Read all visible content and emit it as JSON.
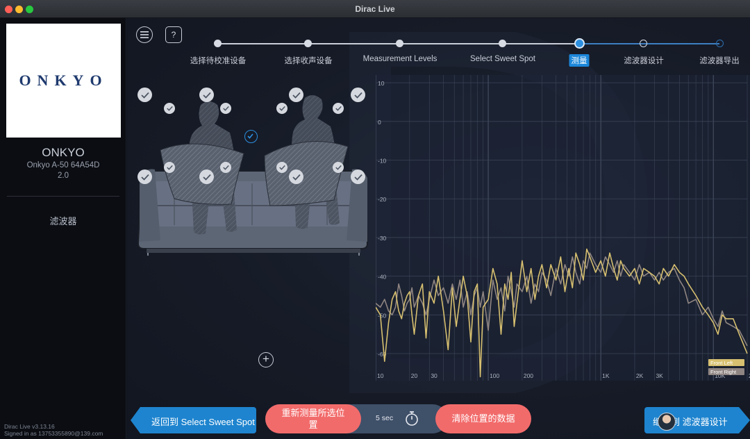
{
  "window": {
    "title": "Dirac Live"
  },
  "sidebar": {
    "logo_text": "ONKYO",
    "device_name": "ONKYO",
    "device_model": "Onkyo A-50 64A54D",
    "device_version": "2.0",
    "filter_label": "滤波器",
    "app_version": "Dirac Live v3.13.16",
    "signed_in": "Signed in as 13753355890@139.com"
  },
  "toolbar": {
    "menu_icon": "hamburger-menu-icon",
    "help_label": "?"
  },
  "stepper": {
    "steps": [
      {
        "label": "选择待校准设备",
        "state": "done"
      },
      {
        "label": "选择收声设备",
        "state": "done"
      },
      {
        "label": "Measurement Levels",
        "state": "done"
      },
      {
        "label": "Select Sweet Spot",
        "state": "done"
      },
      {
        "label": "测量",
        "state": "active"
      },
      {
        "label": "滤波器设计",
        "state": "future"
      },
      {
        "label": "滤波器导出",
        "state": "future"
      }
    ]
  },
  "scene": {
    "add_label": "+"
  },
  "chart_data": {
    "type": "line",
    "xscale": "log",
    "xlim": [
      10,
      20000
    ],
    "ylim": [
      -67,
      12
    ],
    "x_ticks": [
      "10",
      "20",
      "30",
      "100",
      "200",
      "1K",
      "2K",
      "3K",
      "10K",
      "20K"
    ],
    "y_ticks": [
      "10",
      "0",
      "-10",
      "-20",
      "-30",
      "-40",
      "-50",
      "-60"
    ],
    "grid": true,
    "legend_position": "bottom-right",
    "series": [
      {
        "name": "Front Left",
        "color": "#d7c070",
        "x": [
          10,
          11,
          12,
          13,
          14,
          15,
          16,
          17,
          18,
          19,
          20,
          21,
          22,
          24,
          26,
          28,
          30,
          33,
          36,
          40,
          44,
          48,
          52,
          56,
          60,
          65,
          70,
          75,
          80,
          85,
          90,
          100,
          110,
          120,
          130,
          140,
          150,
          160,
          170,
          180,
          200,
          220,
          240,
          260,
          280,
          300,
          330,
          360,
          400,
          440,
          480,
          520,
          560,
          600,
          650,
          700,
          750,
          800,
          900,
          1000,
          1100,
          1200,
          1300,
          1400,
          1500,
          1600,
          1800,
          2000,
          2200,
          2400,
          2700,
          3000,
          3300,
          3600,
          4000,
          4500,
          5000,
          5500,
          6000,
          7000,
          8000,
          9000,
          10000,
          11000,
          12000,
          13000,
          15000,
          17000,
          20000
        ],
        "values": [
          -48,
          -50,
          -62,
          -52,
          -46,
          -44,
          -49,
          -51,
          -47,
          -45,
          -44,
          -50,
          -55,
          -45,
          -42,
          -56,
          -44,
          -47,
          -40,
          -49,
          -59,
          -43,
          -53,
          -46,
          -40,
          -45,
          -57,
          -44,
          -42,
          -66,
          -48,
          -46,
          -38,
          -42,
          -55,
          -42,
          -46,
          -39,
          -53,
          -47,
          -36,
          -44,
          -38,
          -46,
          -40,
          -37,
          -43,
          -37,
          -41,
          -35,
          -44,
          -38,
          -43,
          -34,
          -37,
          -41,
          -33,
          -35,
          -39,
          -36,
          -40,
          -34,
          -38,
          -41,
          -36,
          -38,
          -40,
          -38,
          -42,
          -38,
          -39,
          -40,
          -42,
          -38,
          -40,
          -37,
          -39,
          -40,
          -42,
          -45,
          -48,
          -50,
          -52,
          -55,
          -50,
          -51,
          -51,
          -55,
          -60
        ]
      },
      {
        "name": "Front Right",
        "color": "#8f8582",
        "x": [
          10,
          11,
          12,
          13,
          14,
          15,
          16,
          17,
          18,
          19,
          20,
          21,
          22,
          24,
          26,
          28,
          30,
          33,
          36,
          40,
          44,
          48,
          52,
          56,
          60,
          65,
          70,
          75,
          80,
          85,
          90,
          100,
          110,
          120,
          130,
          140,
          150,
          160,
          170,
          180,
          200,
          220,
          240,
          260,
          280,
          300,
          330,
          360,
          400,
          440,
          480,
          520,
          560,
          600,
          650,
          700,
          750,
          800,
          900,
          1000,
          1100,
          1200,
          1300,
          1400,
          1500,
          1600,
          1800,
          2000,
          2200,
          2400,
          2700,
          3000,
          3300,
          3600,
          4000,
          4500,
          5000,
          5500,
          6000,
          7000,
          8000,
          9000,
          10000,
          11000,
          12000,
          13000,
          15000,
          17000,
          20000
        ],
        "values": [
          -47,
          -48,
          -46,
          -49,
          -50,
          -48,
          -42,
          -45,
          -49,
          -47,
          -46,
          -43,
          -48,
          -45,
          -47,
          -50,
          -46,
          -41,
          -45,
          -43,
          -47,
          -42,
          -46,
          -41,
          -48,
          -44,
          -50,
          -45,
          -43,
          -48,
          -44,
          -54,
          -41,
          -46,
          -43,
          -49,
          -40,
          -44,
          -48,
          -42,
          -44,
          -40,
          -47,
          -42,
          -44,
          -39,
          -41,
          -45,
          -38,
          -42,
          -37,
          -40,
          -35,
          -39,
          -42,
          -36,
          -38,
          -34,
          -37,
          -39,
          -35,
          -37,
          -39,
          -36,
          -40,
          -37,
          -39,
          -41,
          -37,
          -40,
          -39,
          -41,
          -39,
          -41,
          -39,
          -38,
          -41,
          -43,
          -47,
          -46,
          -50,
          -48,
          -51,
          -53,
          -49,
          -52,
          -53,
          -54,
          -58
        ]
      }
    ]
  },
  "bottom_bar": {
    "back_label": "返回到 Select Sweet Spot",
    "remeasure_line1": "重新测量所选位",
    "remeasure_line2": "置",
    "timer_value": "5 sec",
    "clear_label": "清除位置的数据",
    "next_label": "继续到 滤波器设计"
  }
}
